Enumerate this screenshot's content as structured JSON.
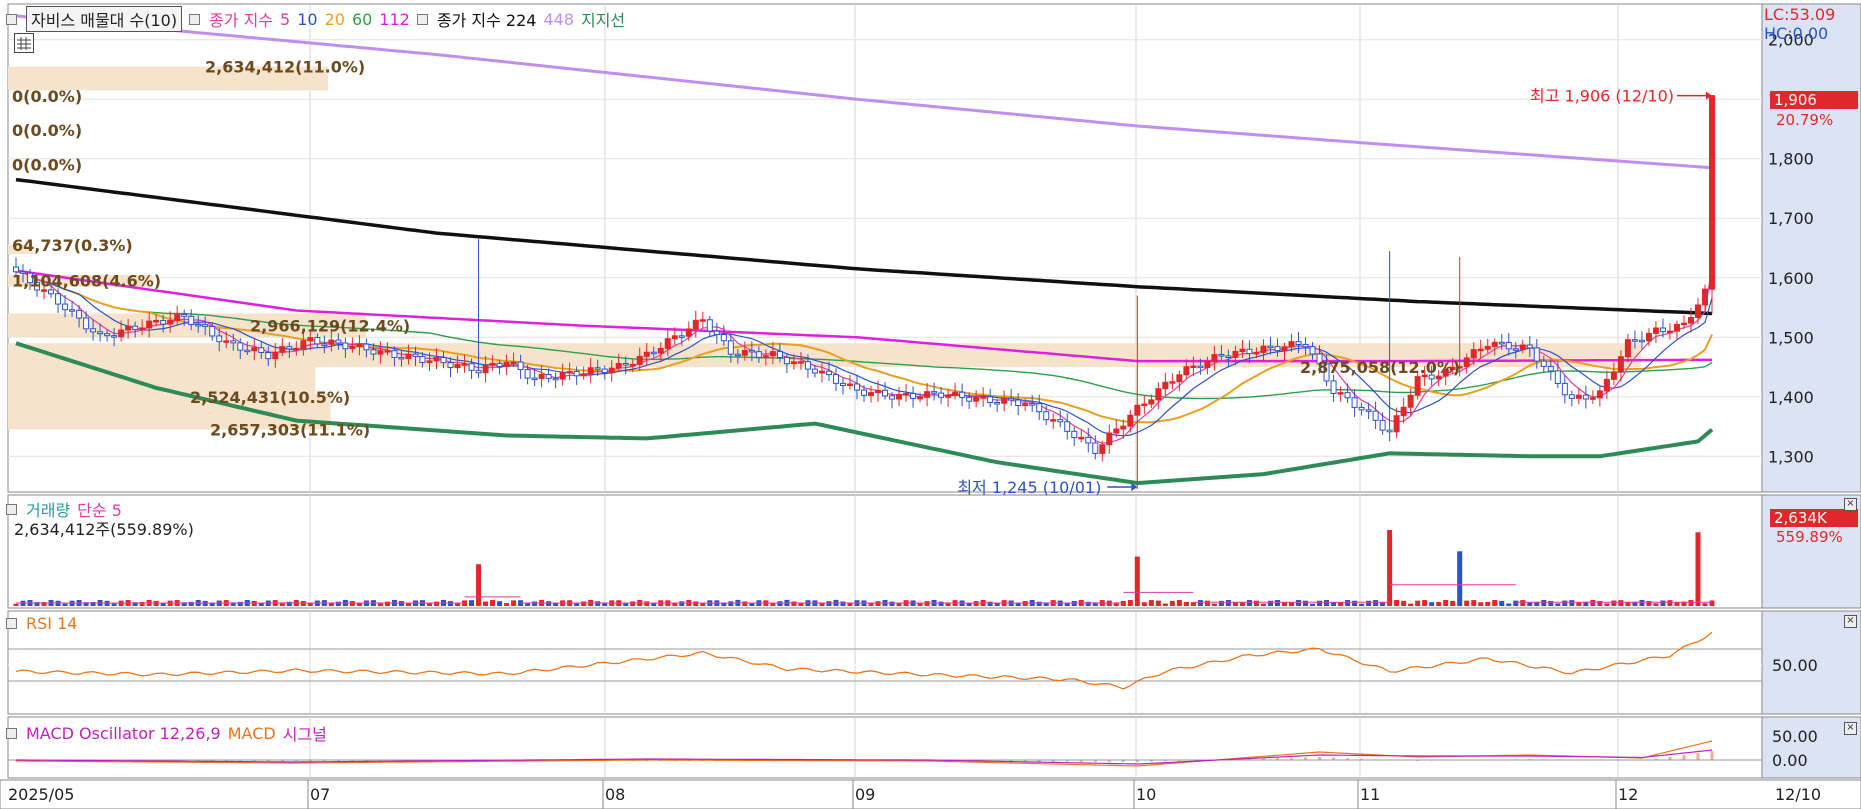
{
  "header": {
    "title": "자비스 매물대 수(10)",
    "ma_label": "종가 지수",
    "ma_periods": [
      "5",
      "10",
      "20",
      "60",
      "112"
    ],
    "ma_long_label": "종가 지수 224",
    "ma_long_extra": "448",
    "support_label": "지지선",
    "lc": "LC:53.09",
    "hc": "HC:0.00"
  },
  "colors": {
    "up": "#e0282a",
    "down": "#2b52c8",
    "ma5": "#e23c9f",
    "ma10": "#2b52c8",
    "ma20": "#e8a020",
    "ma60": "#2da04a",
    "ma112": "#e020e0",
    "ma224": "#101010",
    "ma448": "#c08ef0",
    "support": "#2e8b57",
    "volume_zone": "#f5e3cc"
  },
  "price_axis": {
    "ticks": [
      "2,000",
      "1,900",
      "1,800",
      "1,700",
      "1,600",
      "1,500",
      "1,400",
      "1,300"
    ]
  },
  "x_axis": {
    "ticks": [
      "2025/05",
      "07",
      "08",
      "09",
      "10",
      "11",
      "12",
      "12/10"
    ]
  },
  "annotations": {
    "high": "최고 1,906 (12/10)",
    "low": "최저 1,245 (10/01)",
    "last_price": "1,906",
    "last_change": "20.79%"
  },
  "volume_profile_labels": [
    "2,634,412(11.0%)",
    "0(0.0%)",
    "0(0.0%)",
    "0(0.0%)",
    "64,737(0.3%)",
    "1,104,608(4.6%)",
    "2,966,129(12.4%)",
    "2,875,058(12.0%)",
    "2,524,431(10.5%)",
    "2,657,303(11.1%)"
  ],
  "volume_pane": {
    "title": "거래량",
    "ma_label": "단순 5",
    "value_text": "2,634,412주(559.89%)",
    "last_value": "2,634K",
    "last_change": "559.89%"
  },
  "rsi_pane": {
    "title": "RSI 14",
    "tick": "50.00"
  },
  "macd_pane": {
    "title": "MACD Oscillator 12,26,9",
    "macd_label": "MACD",
    "signal_label": "시그널",
    "ticks": [
      "50.00",
      "0.00"
    ]
  },
  "chart_data": {
    "type": "candlestick",
    "price_ylim": [
      1240,
      2060
    ],
    "high": 1906,
    "low": 1245,
    "close_path": [
      {
        "i": 0,
        "v": 1610
      },
      {
        "i": 6,
        "v": 1560
      },
      {
        "i": 12,
        "v": 1500
      },
      {
        "i": 18,
        "v": 1520
      },
      {
        "i": 24,
        "v": 1535
      },
      {
        "i": 30,
        "v": 1490
      },
      {
        "i": 36,
        "v": 1470
      },
      {
        "i": 42,
        "v": 1495
      },
      {
        "i": 48,
        "v": 1485
      },
      {
        "i": 54,
        "v": 1470
      },
      {
        "i": 60,
        "v": 1460
      },
      {
        "i": 66,
        "v": 1445
      },
      {
        "i": 70,
        "v": 1460
      },
      {
        "i": 74,
        "v": 1430
      },
      {
        "i": 80,
        "v": 1440
      },
      {
        "i": 86,
        "v": 1450
      },
      {
        "i": 90,
        "v": 1470
      },
      {
        "i": 94,
        "v": 1500
      },
      {
        "i": 98,
        "v": 1530
      },
      {
        "i": 102,
        "v": 1475
      },
      {
        "i": 108,
        "v": 1470
      },
      {
        "i": 114,
        "v": 1445
      },
      {
        "i": 120,
        "v": 1410
      },
      {
        "i": 126,
        "v": 1400
      },
      {
        "i": 132,
        "v": 1405
      },
      {
        "i": 138,
        "v": 1395
      },
      {
        "i": 144,
        "v": 1390
      },
      {
        "i": 150,
        "v": 1345
      },
      {
        "i": 154,
        "v": 1310
      },
      {
        "i": 160,
        "v": 1380
      },
      {
        "i": 166,
        "v": 1440
      },
      {
        "i": 172,
        "v": 1470
      },
      {
        "i": 178,
        "v": 1480
      },
      {
        "i": 184,
        "v": 1490
      },
      {
        "i": 188,
        "v": 1410
      },
      {
        "i": 192,
        "v": 1380
      },
      {
        "i": 196,
        "v": 1340
      },
      {
        "i": 200,
        "v": 1430
      },
      {
        "i": 204,
        "v": 1440
      },
      {
        "i": 210,
        "v": 1490
      },
      {
        "i": 216,
        "v": 1480
      },
      {
        "i": 222,
        "v": 1395
      },
      {
        "i": 226,
        "v": 1405
      },
      {
        "i": 230,
        "v": 1490
      },
      {
        "i": 234,
        "v": 1510
      },
      {
        "i": 238,
        "v": 1520
      },
      {
        "i": 241,
        "v": 1575
      },
      {
        "i": 242,
        "v": 1906
      }
    ],
    "ma224": [
      {
        "i": 0,
        "v": 1765
      },
      {
        "i": 60,
        "v": 1675
      },
      {
        "i": 120,
        "v": 1615
      },
      {
        "i": 160,
        "v": 1585
      },
      {
        "i": 200,
        "v": 1560
      },
      {
        "i": 242,
        "v": 1540
      }
    ],
    "ma448": [
      {
        "i": 0,
        "v": 2040
      },
      {
        "i": 60,
        "v": 1975
      },
      {
        "i": 120,
        "v": 1900
      },
      {
        "i": 160,
        "v": 1855
      },
      {
        "i": 200,
        "v": 1820
      },
      {
        "i": 242,
        "v": 1785
      }
    ],
    "ma112": [
      {
        "i": 0,
        "v": 1612
      },
      {
        "i": 40,
        "v": 1545
      },
      {
        "i": 80,
        "v": 1520
      },
      {
        "i": 120,
        "v": 1500
      },
      {
        "i": 160,
        "v": 1460
      },
      {
        "i": 200,
        "v": 1460
      },
      {
        "i": 240,
        "v": 1462
      }
    ],
    "support": [
      {
        "i": 0,
        "v": 1490
      },
      {
        "i": 20,
        "v": 1415
      },
      {
        "i": 40,
        "v": 1360
      },
      {
        "i": 70,
        "v": 1335
      },
      {
        "i": 90,
        "v": 1330
      },
      {
        "i": 114,
        "v": 1355
      },
      {
        "i": 140,
        "v": 1290
      },
      {
        "i": 160,
        "v": 1255
      },
      {
        "i": 178,
        "v": 1270
      },
      {
        "i": 196,
        "v": 1305
      },
      {
        "i": 216,
        "v": 1300
      },
      {
        "i": 226,
        "v": 1300
      },
      {
        "i": 240,
        "v": 1325
      },
      {
        "i": 242,
        "v": 1345
      }
    ],
    "volume_spikes": [
      {
        "i": 66,
        "v": 0.55
      },
      {
        "i": 160,
        "v": 0.65
      },
      {
        "i": 196,
        "v": 1.0
      },
      {
        "i": 206,
        "v": 0.72,
        "down": true
      },
      {
        "i": 240,
        "v": 0.97
      }
    ],
    "volume_ma_steps": [
      {
        "from": 0,
        "to": 64,
        "v": 0.04
      },
      {
        "from": 64,
        "to": 72,
        "v": 0.12
      },
      {
        "from": 72,
        "to": 158,
        "v": 0.04
      },
      {
        "from": 158,
        "to": 168,
        "v": 0.18
      },
      {
        "from": 168,
        "to": 196,
        "v": 0.05
      },
      {
        "from": 196,
        "to": 214,
        "v": 0.28
      },
      {
        "from": 214,
        "to": 242,
        "v": 0.05
      }
    ],
    "rsi_path": [
      {
        "i": 0,
        "v": 42
      },
      {
        "i": 20,
        "v": 38
      },
      {
        "i": 40,
        "v": 43
      },
      {
        "i": 70,
        "v": 39
      },
      {
        "i": 98,
        "v": 65
      },
      {
        "i": 110,
        "v": 45
      },
      {
        "i": 130,
        "v": 38
      },
      {
        "i": 150,
        "v": 32
      },
      {
        "i": 158,
        "v": 22
      },
      {
        "i": 164,
        "v": 42
      },
      {
        "i": 176,
        "v": 62
      },
      {
        "i": 186,
        "v": 70
      },
      {
        "i": 196,
        "v": 42
      },
      {
        "i": 210,
        "v": 58
      },
      {
        "i": 222,
        "v": 40
      },
      {
        "i": 236,
        "v": 62
      },
      {
        "i": 242,
        "v": 90
      }
    ],
    "macd_path": [
      {
        "i": 0,
        "v": -2
      },
      {
        "i": 40,
        "v": -6
      },
      {
        "i": 90,
        "v": 0
      },
      {
        "i": 130,
        "v": -2
      },
      {
        "i": 160,
        "v": -12
      },
      {
        "i": 186,
        "v": 16
      },
      {
        "i": 200,
        "v": 6
      },
      {
        "i": 216,
        "v": 10
      },
      {
        "i": 232,
        "v": 4
      },
      {
        "i": 242,
        "v": 38
      }
    ],
    "signal_path": [
      {
        "i": 0,
        "v": 0
      },
      {
        "i": 40,
        "v": -4
      },
      {
        "i": 90,
        "v": 2
      },
      {
        "i": 130,
        "v": 0
      },
      {
        "i": 160,
        "v": -8
      },
      {
        "i": 186,
        "v": 10
      },
      {
        "i": 200,
        "v": 8
      },
      {
        "i": 216,
        "v": 8
      },
      {
        "i": 232,
        "v": 5
      },
      {
        "i": 242,
        "v": 20
      }
    ]
  }
}
